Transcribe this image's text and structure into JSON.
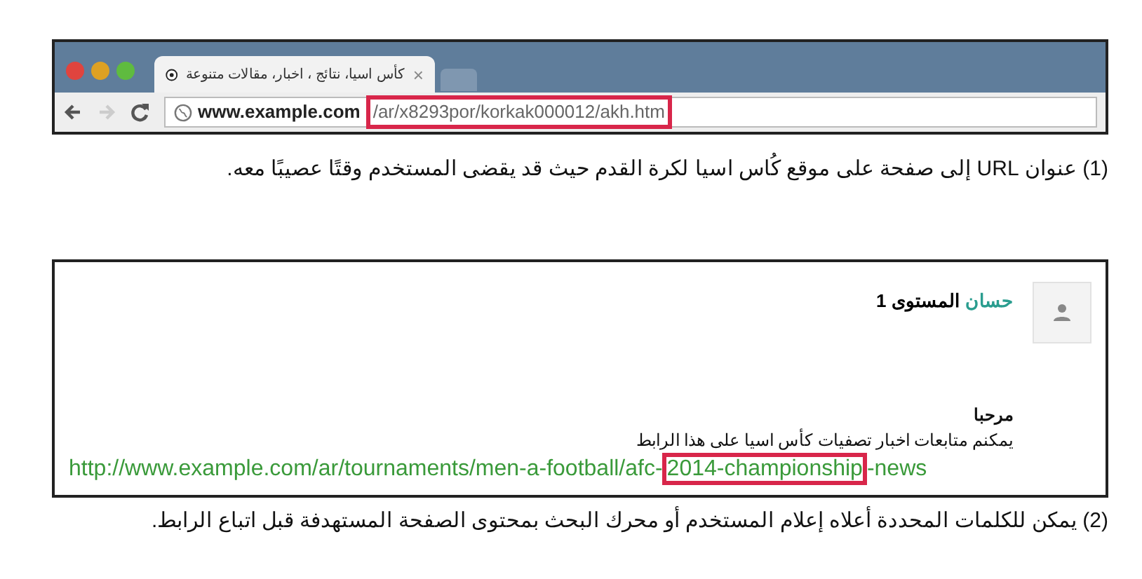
{
  "browser": {
    "tab": {
      "title": "كأس اسيا، نتائج ، اخبار، مقالات متنوعة",
      "close": "×"
    },
    "address": {
      "domain": "www.example.com",
      "highlight": "/ar/x8293por/korkak000012/akh.htm"
    }
  },
  "caption_1": "(1) عنوان URL إلى صفحة على موقع كُاس اسيا لكرة القدم حيث قد يقضى المستخدم وقتًا عصيبًا معه.",
  "comment": {
    "author": "حسان",
    "level": "المستوى 1",
    "greeting": "مرحبا",
    "body": "يمكنم متابعات اخبار تصفيات كأس اسيا على هذا الرابط",
    "link": {
      "before": "http://www.example.com/ar/tournaments/men-a-football/afc-",
      "highlight": "2014-championship",
      "after": "-news"
    }
  },
  "caption_2": "(2) يمكن للكلمات المحددة أعلاه إعلام المستخدم أو محرك البحث بمحتوى الصفحة المستهدفة قبل اتباع الرابط."
}
